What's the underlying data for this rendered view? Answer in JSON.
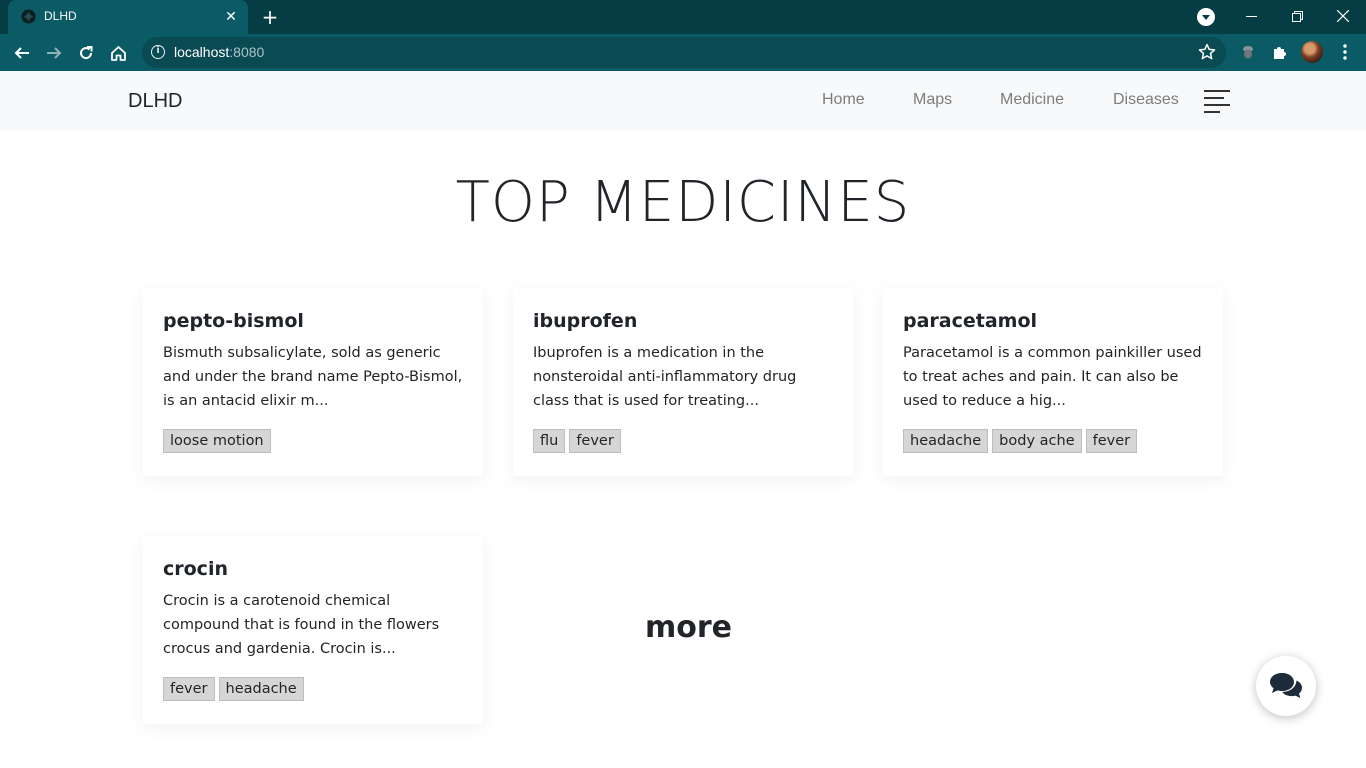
{
  "browser": {
    "tab_title": "DLHD",
    "close_glyph": "✕",
    "new_tab_glyph": "+",
    "url_host": "localhost",
    "url_port": ":8080",
    "info_glyph": "i"
  },
  "navbar": {
    "brand": "DLHD",
    "links": [
      "Home",
      "Maps",
      "Medicine",
      "Diseases"
    ]
  },
  "page": {
    "heading": "TOP MEDICINES",
    "more_label": "more"
  },
  "cards": [
    {
      "title": "pepto-bismol",
      "description": "Bismuth subsalicylate, sold as generic and under the brand name Pepto-Bismol, is an antacid elixir m...",
      "tags": [
        "loose motion"
      ]
    },
    {
      "title": "ibuprofen",
      "description": "Ibuprofen is a medication in the nonsteroidal anti-inflammatory drug class that is used for treating...",
      "tags": [
        "flu",
        "fever"
      ]
    },
    {
      "title": "paracetamol",
      "description": "Paracetamol is a common painkiller used to treat aches and pain. It can also be used to reduce a hig...",
      "tags": [
        "headache",
        "body ache",
        "fever"
      ]
    },
    {
      "title": "crocin",
      "description": "Crocin is a carotenoid chemical compound that is found in the flowers crocus and gardenia. Crocin is...",
      "tags": [
        "fever",
        "headache"
      ]
    }
  ],
  "colors": {
    "browser_frame": "#063c43",
    "browser_toolbar": "#0b5b66",
    "navbar_bg": "#f8f9fa",
    "tag_bg": "#d6d6d6"
  },
  "icons": {
    "chat": "chat-bubbles-icon",
    "menu": "hamburger-menu-icon"
  }
}
